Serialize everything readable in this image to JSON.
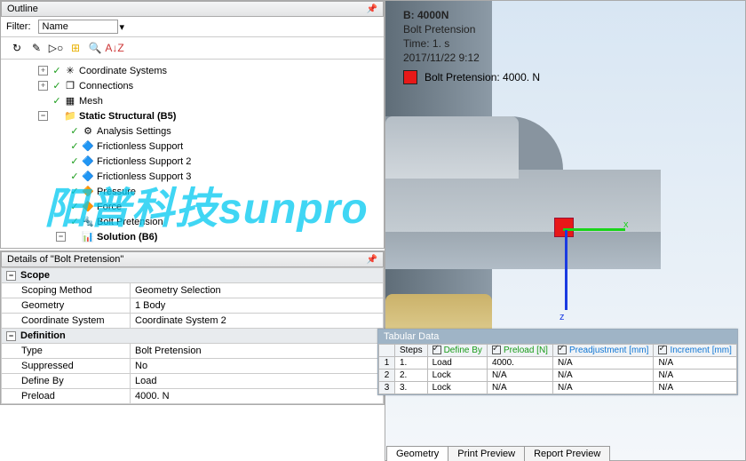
{
  "outline": {
    "title": "Outline",
    "filter_label": "Filter:",
    "filter_field": "Name",
    "tree": {
      "coordinate_systems": "Coordinate Systems",
      "connections": "Connections",
      "mesh": "Mesh",
      "static_structural": "Static Structural (B5)",
      "analysis_settings": "Analysis Settings",
      "frictionless_support": "Frictionless Support",
      "frictionless_support2": "Frictionless Support 2",
      "frictionless_support3": "Frictionless Support 3",
      "pressure": "Pressure",
      "force": "Force",
      "bolt_pretension": "Bolt Pretension",
      "solution": "Solution (B6)"
    }
  },
  "details": {
    "title": "Details of \"Bolt Pretension\"",
    "scope": {
      "header": "Scope",
      "scoping_method": {
        "k": "Scoping Method",
        "v": "Geometry Selection"
      },
      "geometry": {
        "k": "Geometry",
        "v": "1 Body"
      },
      "coord_sys": {
        "k": "Coordinate System",
        "v": "Coordinate System 2"
      }
    },
    "definition": {
      "header": "Definition",
      "type": {
        "k": "Type",
        "v": "Bolt Pretension"
      },
      "suppressed": {
        "k": "Suppressed",
        "v": "No"
      },
      "define_by": {
        "k": "Define By",
        "v": "Load"
      },
      "preload": {
        "k": "Preload",
        "v": "4000. N"
      }
    }
  },
  "viewport": {
    "b": "B: 4000N",
    "name": "Bolt Pretension",
    "time": "Time: 1. s",
    "timestamp": "2017/11/22 9:12",
    "legend": "Bolt Pretension: 4000. N",
    "watermark": "阳普科技sunpro"
  },
  "tabular": {
    "title": "Tabular Data",
    "headers": {
      "steps": "Steps",
      "define_by": "Define By",
      "preload": "Preload [N]",
      "preadj": "Preadjustment [mm]",
      "incr": "Increment [mm]"
    },
    "rows": [
      {
        "n": "1",
        "steps": "1.",
        "define": "Load",
        "preload": "4000.",
        "preadj": "N/A",
        "incr": "N/A"
      },
      {
        "n": "2",
        "steps": "2.",
        "define": "Lock",
        "preload": "N/A",
        "preadj": "N/A",
        "incr": "N/A"
      },
      {
        "n": "3",
        "steps": "3.",
        "define": "Lock",
        "preload": "N/A",
        "preadj": "N/A",
        "incr": "N/A"
      }
    ]
  },
  "tabs": {
    "geometry": "Geometry",
    "print": "Print Preview",
    "report": "Report Preview"
  },
  "axis": {
    "x": "x",
    "y": "z"
  }
}
